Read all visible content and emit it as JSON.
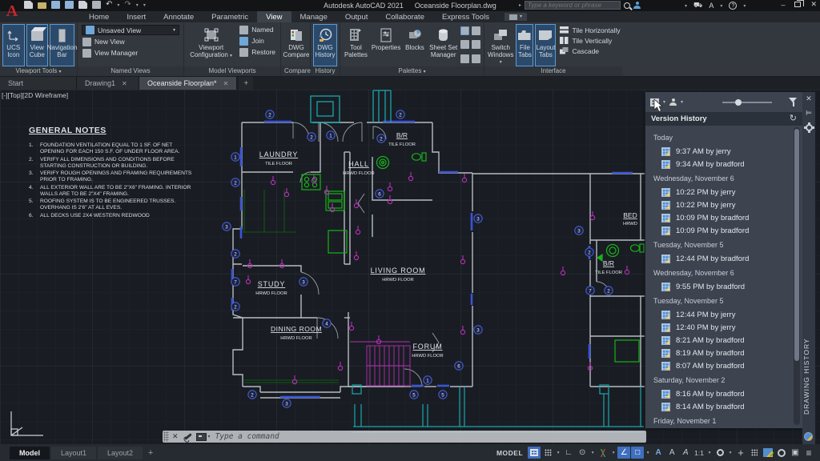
{
  "glyphs": {
    "caret": "▾",
    "caret_right": "▸",
    "plus": "+",
    "close": "✕",
    "minimize": "–",
    "undo": "↶",
    "redo": "↷",
    "help": "?",
    "cart": "⛟",
    "a_mark": "A",
    "refresh": "↻",
    "ortho": "∟",
    "polar": "⊙",
    "angle": "∠",
    "square": "□",
    "anno_a": "A",
    "hamburger": "≡",
    "cleanscreen": "▣",
    "crosshair": "+"
  },
  "titlebar": {
    "app_title": "Autodesk AutoCAD 2021",
    "doc_title": "Oceanside Floorplan.dwg",
    "search_placeholder": "Type a keyword or phrase"
  },
  "ribbon_tabs": [
    "Home",
    "Insert",
    "Annotate",
    "Parametric",
    "View",
    "Manage",
    "Output",
    "Collaborate",
    "Express Tools"
  ],
  "ribbon": {
    "viewport_tools": {
      "label": "Viewport Tools",
      "ucs_icon": "UCS Icon",
      "view_cube": "View Cube",
      "navigation_bar": "Navigation Bar"
    },
    "named_views": {
      "label": "Named Views",
      "dropdown_value": "Unsaved View",
      "new_view": "New View",
      "view_manager": "View Manager"
    },
    "model_viewports": {
      "label": "Model Viewports",
      "viewport_configuration": "Viewport Configuration",
      "named": "Named",
      "join": "Join",
      "restore": "Restore"
    },
    "compare": {
      "label": "Compare",
      "dwg_compare": "DWG Compare"
    },
    "history": {
      "label": "History",
      "dwg_history": "DWG History"
    },
    "palettes": {
      "label": "Palettes",
      "tool_palettes": "Tool Palettes",
      "properties": "Properties",
      "blocks": "Blocks",
      "sheet_set_manager": "Sheet Set Manager"
    },
    "interface": {
      "label": "Interface",
      "switch_windows": "Switch Windows",
      "file_tabs": "File Tabs",
      "layout_tabs": "Layout Tabs",
      "tile_horizontally": "Tile Horizontally",
      "tile_vertically": "Tile Vertically",
      "cascade": "Cascade"
    }
  },
  "file_tabs": {
    "start": "Start",
    "drawing1": "Drawing1",
    "active_doc": "Oceanside Floorplan*"
  },
  "canvas": {
    "viewport_label": "[-][Top][2D Wireframe]",
    "notes": {
      "title": "GENERAL NOTES",
      "items": [
        "FOUNDATION VENTILATION EQUAL TO 1 SF. OF NET OPENING FOR EACH 150 S.F. OF UNDER FLOOR AREA.",
        "VERIFY ALL DIMENSIONS AND CONDITIONS BEFORE STARTING CONSTRUCTION OR BUILDING.",
        "VERIFY ROUGH OPENINGS AND FRAMING REQUIREMENTS PRIOR TO FRAMING.",
        "ALL EXTERIOR WALL ARE TO BE 2\"X6\" FRAMING. INTERIOR WALLS ARE TO BE 2\"X4\" FRAMING.",
        "ROOFING SYSTEM IS TO BE ENGINEERED TRUSSES. OVERHANG IS 2'6\" AT ALL EVES.",
        "ALL DECKS USE 2X4 WESTERN REDWOOD"
      ]
    },
    "rooms": [
      {
        "name": "LAUNDRY",
        "floor": "TILE FLOOR"
      },
      {
        "name": "HALL",
        "floor": "HRWD FLOOR"
      },
      {
        "name": "B/R",
        "floor": "TILE FLOOR"
      },
      {
        "name": "BED",
        "floor": "HRWD"
      },
      {
        "name": "B/R",
        "floor": "TILE FLOOR"
      },
      {
        "name": "STUDY",
        "floor": "HRWD FLOOR"
      },
      {
        "name": "LIVING ROOM",
        "floor": "HRWD FLOOR"
      },
      {
        "name": "DINING ROOM",
        "floor": "HRWD FLOOR"
      },
      {
        "name": "FORUM",
        "floor": "HRWD FLOOR"
      }
    ],
    "callouts": [
      "2",
      "2",
      "2",
      "1",
      "2",
      "1",
      "2",
      "3",
      "2",
      "7",
      "2",
      "3",
      "6",
      "4",
      "3",
      "3",
      "6",
      "1",
      "5",
      "5",
      "2",
      "3",
      "3",
      "2",
      "7",
      "2"
    ],
    "command_placeholder": "Type a command"
  },
  "palette": {
    "title": "Version History",
    "side_label": "DRAWING HISTORY",
    "groups": [
      {
        "date": "Today",
        "entries": [
          {
            "text": "9:37 AM by jerry"
          },
          {
            "text": "9:34 AM by bradford"
          }
        ]
      },
      {
        "date": "Wednesday, November 6",
        "entries": [
          {
            "text": "10:22 PM by jerry"
          },
          {
            "text": "10:22 PM by jerry"
          },
          {
            "text": "10:09 PM by bradford"
          },
          {
            "text": "10:09 PM by bradford"
          }
        ]
      },
      {
        "date": "Tuesday, November 5",
        "entries": [
          {
            "text": "12:44 PM by bradford"
          }
        ]
      },
      {
        "date": "Wednesday, November 6",
        "entries": [
          {
            "text": "9:55 PM by bradford"
          }
        ]
      },
      {
        "date": "Tuesday, November 5",
        "entries": [
          {
            "text": "12:44 PM by jerry"
          },
          {
            "text": "12:40 PM by jerry"
          },
          {
            "text": "8:21 AM by bradford"
          },
          {
            "text": "8:19 AM by bradford"
          },
          {
            "text": "8:07 AM by bradford"
          }
        ]
      },
      {
        "date": "Saturday, November 2",
        "entries": [
          {
            "text": "8:16 AM by bradford"
          },
          {
            "text": "8:14 AM by bradford"
          }
        ]
      },
      {
        "date": "Friday, November 1",
        "entries": []
      }
    ]
  },
  "statusbar": {
    "model_tab": "Model",
    "layout1_tab": "Layout1",
    "layout2_tab": "Layout2",
    "model_label": "MODEL",
    "scale": "1:1"
  }
}
